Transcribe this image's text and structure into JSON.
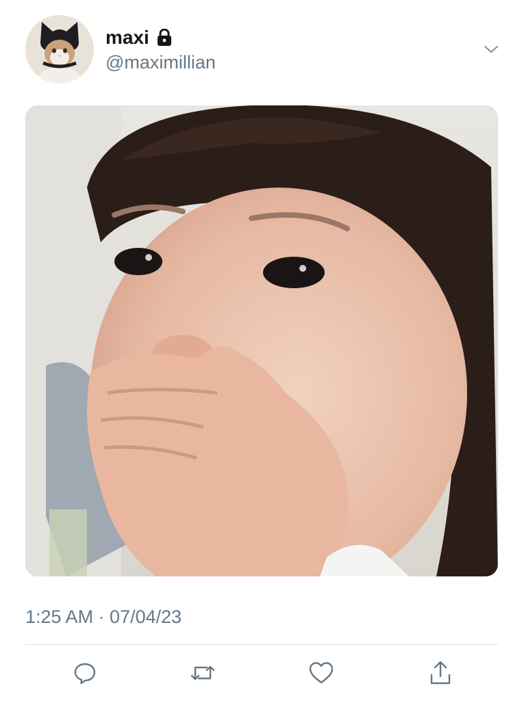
{
  "tweet": {
    "display_name": "maxi",
    "handle": "@maximillian",
    "timestamp": "1:25 AM · 07/04/23",
    "protected": true
  },
  "icons": {
    "lock": "lock-icon",
    "menu": "chevron-down-icon",
    "reply": "reply-icon",
    "retweet": "retweet-icon",
    "like": "heart-icon",
    "share": "share-icon"
  },
  "colors": {
    "text_primary": "#14171a",
    "text_secondary": "#657786",
    "divider": "#d8dee3",
    "icon": "#657786"
  }
}
